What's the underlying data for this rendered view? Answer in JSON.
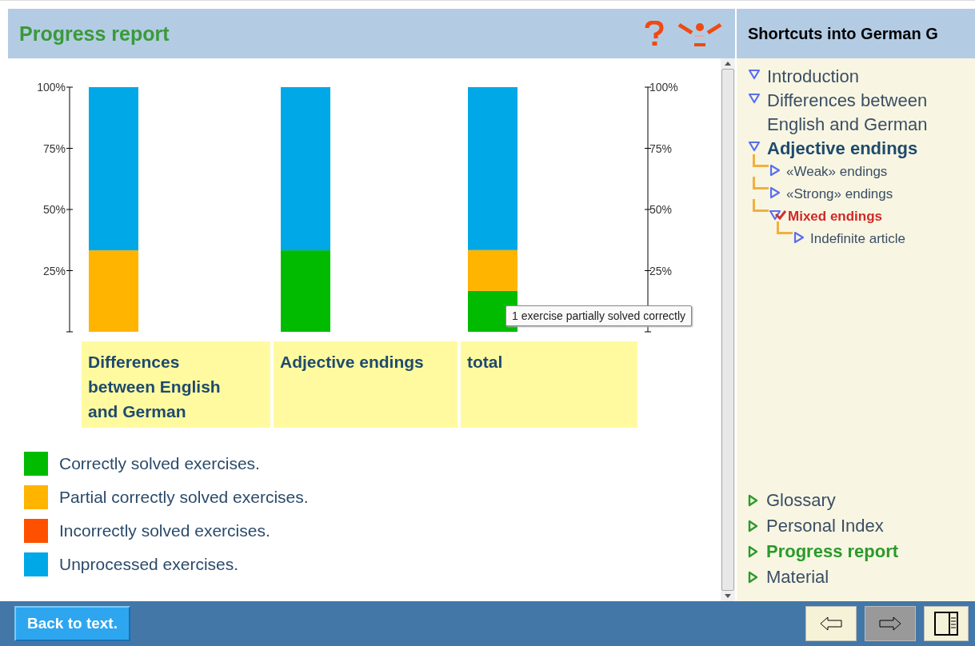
{
  "main": {
    "title": "Progress report",
    "chart_data": {
      "type": "bar",
      "stacked": true,
      "orientation": "vertical",
      "categories": [
        "Differences between English and German",
        "Adjective endings",
        "total"
      ],
      "ylim": [
        0,
        100
      ],
      "yticks": [
        {
          "value": 25,
          "label": "25%"
        },
        {
          "value": 50,
          "label": "50%"
        },
        {
          "value": 75,
          "label": "75%"
        },
        {
          "value": 100,
          "label": "100%"
        }
      ],
      "series": [
        {
          "name": "Correctly solved exercises.",
          "color": "#00bb00",
          "values": [
            0,
            33.3,
            16.7
          ]
        },
        {
          "name": "Partial correctly solved exercises.",
          "color": "#ffb400",
          "values": [
            33.3,
            0,
            16.7
          ]
        },
        {
          "name": "Incorrectly solved exercises.",
          "color": "#ff5000",
          "values": [
            0,
            0,
            0
          ]
        },
        {
          "name": "Unprocessed exercises.",
          "color": "#00a8e8",
          "values": [
            66.7,
            66.7,
            66.6
          ]
        }
      ]
    },
    "tooltip": "1 exercise partially solved correctly",
    "back_button": "Back to text."
  },
  "sidebar": {
    "title": "Shortcuts into German G",
    "tree": [
      {
        "label": "Introduction",
        "expanded": true,
        "selected": false
      },
      {
        "label": "Differences between English and German",
        "expanded": true,
        "selected": false
      },
      {
        "label": "Adjective endings",
        "expanded": true,
        "selected": false,
        "children": [
          {
            "label": "«Weak» endings",
            "expanded": false,
            "selected": false
          },
          {
            "label": "«Strong» endings",
            "expanded": false,
            "selected": false
          },
          {
            "label": "Mixed endings",
            "expanded": true,
            "selected": true,
            "children": [
              {
                "label": "Indefinite article",
                "expanded": false,
                "selected": false
              }
            ]
          }
        ]
      }
    ],
    "links": [
      {
        "label": "Glossary",
        "selected": false
      },
      {
        "label": "Personal Index",
        "selected": false
      },
      {
        "label": "Progress report",
        "selected": true
      },
      {
        "label": "Material",
        "selected": false
      }
    ]
  }
}
